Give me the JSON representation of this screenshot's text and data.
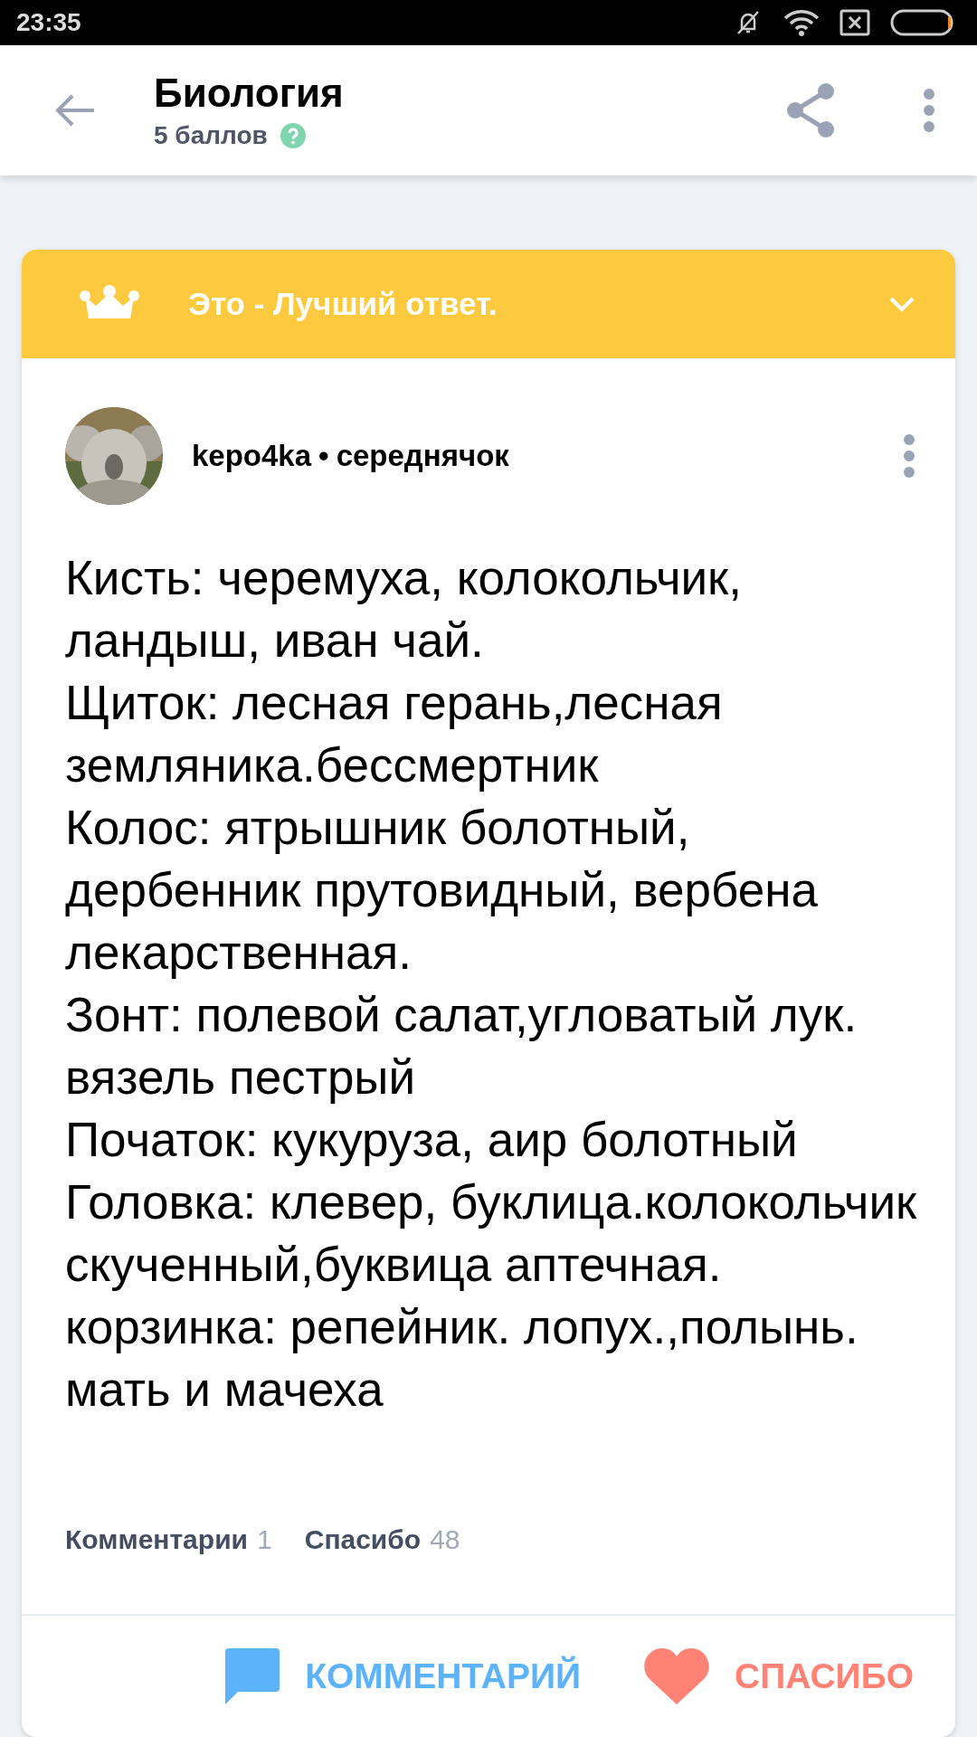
{
  "status_bar": {
    "time": "23:35"
  },
  "header": {
    "title": "Биология",
    "points": "5 баллов"
  },
  "answer": {
    "banner": "Это - Лучший ответ.",
    "author": "kepo4ka",
    "separator": "•",
    "rank": "середнячок",
    "lines": [
      "Кисть: черемуха, колокольчик, ландыш, иван чай.",
      "Щиток: лесная герань,лесная земляника.бессмертник",
      "Колос: ятрышник болотный, дербенник прутовидный, вербена лекарственная.",
      "Зонт: полевой салат,угловатый лук. вязель пестрый",
      "Початок: кукуруза, аир болотный",
      "Головка: клевер, буклица.колокольчик скученный,буквица аптечная.",
      "корзинка: репейник. лопух.,полынь. мать и мачеха"
    ],
    "stats": [
      {
        "label": "Комментарии",
        "count": "1"
      },
      {
        "label": "Спасибо",
        "count": "48"
      }
    ],
    "actions": [
      {
        "kind": "comment",
        "label": "КОММЕНТАРИЙ"
      },
      {
        "kind": "thanks",
        "label": "СПАСИБО"
      }
    ]
  }
}
